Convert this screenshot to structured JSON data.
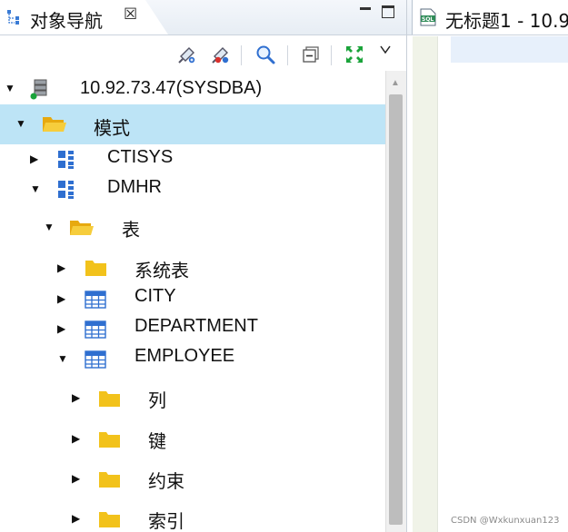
{
  "navigator": {
    "tab_title": "对象导航",
    "tab_close_glyph": "☒",
    "toolbar": [
      {
        "name": "connect-icon"
      },
      {
        "name": "disconnect-icon"
      },
      {
        "name": "search-icon"
      },
      {
        "name": "collapse-all-icon"
      },
      {
        "name": "expand-icon"
      }
    ],
    "tree": [
      {
        "label": "10.92.73.47(SYSDBA)",
        "icon": "server-icon",
        "toggle": "▼",
        "expanded": true
      },
      {
        "label": "模式",
        "icon": "folder-open-icon",
        "toggle": "▼",
        "expanded": true,
        "selected": true
      },
      {
        "label": "CTISYS",
        "icon": "schema-icon",
        "toggle": "▶",
        "expanded": false
      },
      {
        "label": "DMHR",
        "icon": "schema-icon",
        "toggle": "▼",
        "expanded": true
      },
      {
        "label": "表",
        "icon": "folder-open-icon",
        "toggle": "▼",
        "expanded": true
      },
      {
        "label": "系统表",
        "icon": "folder-icon",
        "toggle": "▶",
        "expanded": false
      },
      {
        "label": "CITY",
        "icon": "table-icon",
        "toggle": "▶",
        "expanded": false
      },
      {
        "label": "DEPARTMENT",
        "icon": "table-icon",
        "toggle": "▶",
        "expanded": false
      },
      {
        "label": "EMPLOYEE",
        "icon": "table-icon",
        "toggle": "▼",
        "expanded": true
      },
      {
        "label": "列",
        "icon": "folder-icon",
        "toggle": "▶",
        "expanded": false
      },
      {
        "label": "键",
        "icon": "folder-icon",
        "toggle": "▶",
        "expanded": false
      },
      {
        "label": "约束",
        "icon": "folder-icon",
        "toggle": "▶",
        "expanded": false
      },
      {
        "label": "索引",
        "icon": "folder-icon",
        "toggle": "▶",
        "expanded": false
      }
    ]
  },
  "editor": {
    "tab_title": "无标题1 - 10.9"
  },
  "watermark": "CSDN @Wxkunxuan123",
  "colors": {
    "selection": "#bde4f6",
    "folder": "#f2c21b",
    "table_blue": "#2f6fd0",
    "expand_green": "#1aa33a"
  }
}
